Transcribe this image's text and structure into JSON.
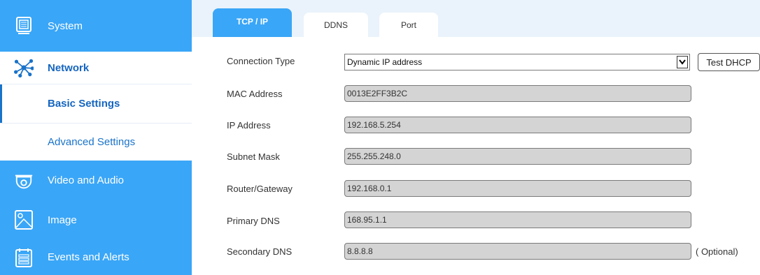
{
  "sidebar": {
    "items": [
      {
        "label": "System",
        "icon": "system-icon"
      },
      {
        "label": "Network",
        "icon": "network-icon"
      },
      {
        "label": "Basic Settings"
      },
      {
        "label": "Advanced Settings"
      },
      {
        "label": "Video and Audio",
        "icon": "camera-icon"
      },
      {
        "label": "Image",
        "icon": "image-icon"
      },
      {
        "label": "Events and Alerts",
        "icon": "events-icon"
      }
    ]
  },
  "tabs": [
    {
      "label": "TCP / IP",
      "active": true
    },
    {
      "label": "DDNS",
      "active": false
    },
    {
      "label": "Port",
      "active": false
    }
  ],
  "form": {
    "connection_type": {
      "label": "Connection Type",
      "value": "Dynamic IP address",
      "button": "Test DHCP"
    },
    "mac": {
      "label": "MAC Address",
      "value": "0013E2FF3B2C"
    },
    "ip": {
      "label": "IP Address",
      "value": "192.168.5.254"
    },
    "subnet": {
      "label": "Subnet Mask",
      "value": "255.255.248.0"
    },
    "gateway": {
      "label": "Router/Gateway",
      "value": "192.168.0.1"
    },
    "dns1": {
      "label": "Primary DNS",
      "value": "168.95.1.1"
    },
    "dns2": {
      "label": "Secondary DNS",
      "value": "8.8.8.8",
      "note": "( Optional)"
    }
  },
  "colors": {
    "accent": "#3aa6f7",
    "link": "#1565c0",
    "field_bg": "#d4d4d4",
    "tabbar_bg": "#eaf3fb"
  }
}
